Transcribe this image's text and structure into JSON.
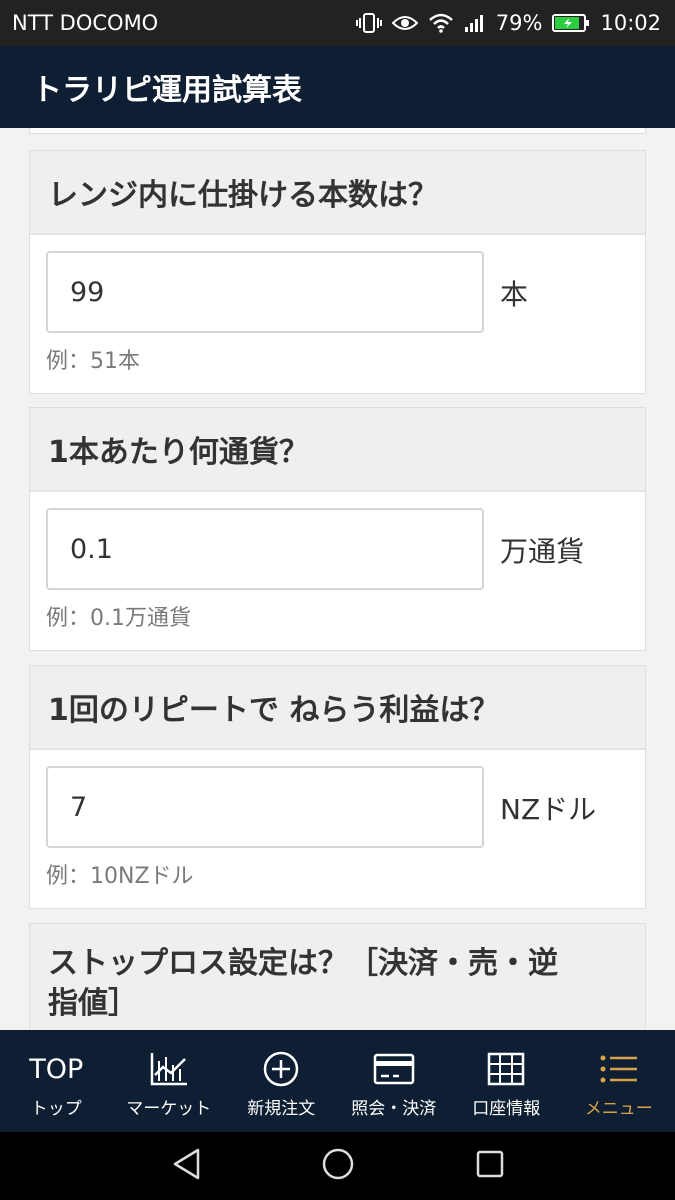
{
  "status_bar": {
    "carrier": "NTT DOCOMO",
    "battery_percent": "79%",
    "time": "10:02",
    "icons": [
      "vibrate-icon",
      "eye-icon",
      "wifi-icon",
      "signal-icon",
      "battery-icon"
    ]
  },
  "app_bar": {
    "title": "トラリピ運用試算表"
  },
  "questions": [
    {
      "title": "レンジ内に仕掛ける本数は？",
      "value": "99",
      "unit": "本",
      "example": "例：51本"
    },
    {
      "title": "1本あたり何通貨？",
      "value": "0.1",
      "unit": "万通貨",
      "example": "例：0.1万通貨"
    },
    {
      "title": "1回のリピートで ねらう利益は？",
      "value": "7",
      "unit": "NZドル",
      "example": "例：10NZドル"
    },
    {
      "title_line1": "ストップロス設定は？［決済・売・逆",
      "title_line2": "指値］"
    }
  ],
  "tab_bar": {
    "items": [
      {
        "label": "トップ",
        "icon_text": "TOP",
        "icon": "top-icon"
      },
      {
        "label": "マーケット",
        "icon": "chart-icon"
      },
      {
        "label": "新規注文",
        "icon": "plus-circle-icon"
      },
      {
        "label": "照会・決済",
        "icon": "card-icon"
      },
      {
        "label": "口座情報",
        "icon": "grid-icon"
      },
      {
        "label": "メニュー",
        "icon": "menu-icon"
      }
    ],
    "active_color": "#d8a24a"
  },
  "colors": {
    "app_bar": "#0e1f33",
    "status_bar": "#222222",
    "card_header": "#efefef"
  }
}
